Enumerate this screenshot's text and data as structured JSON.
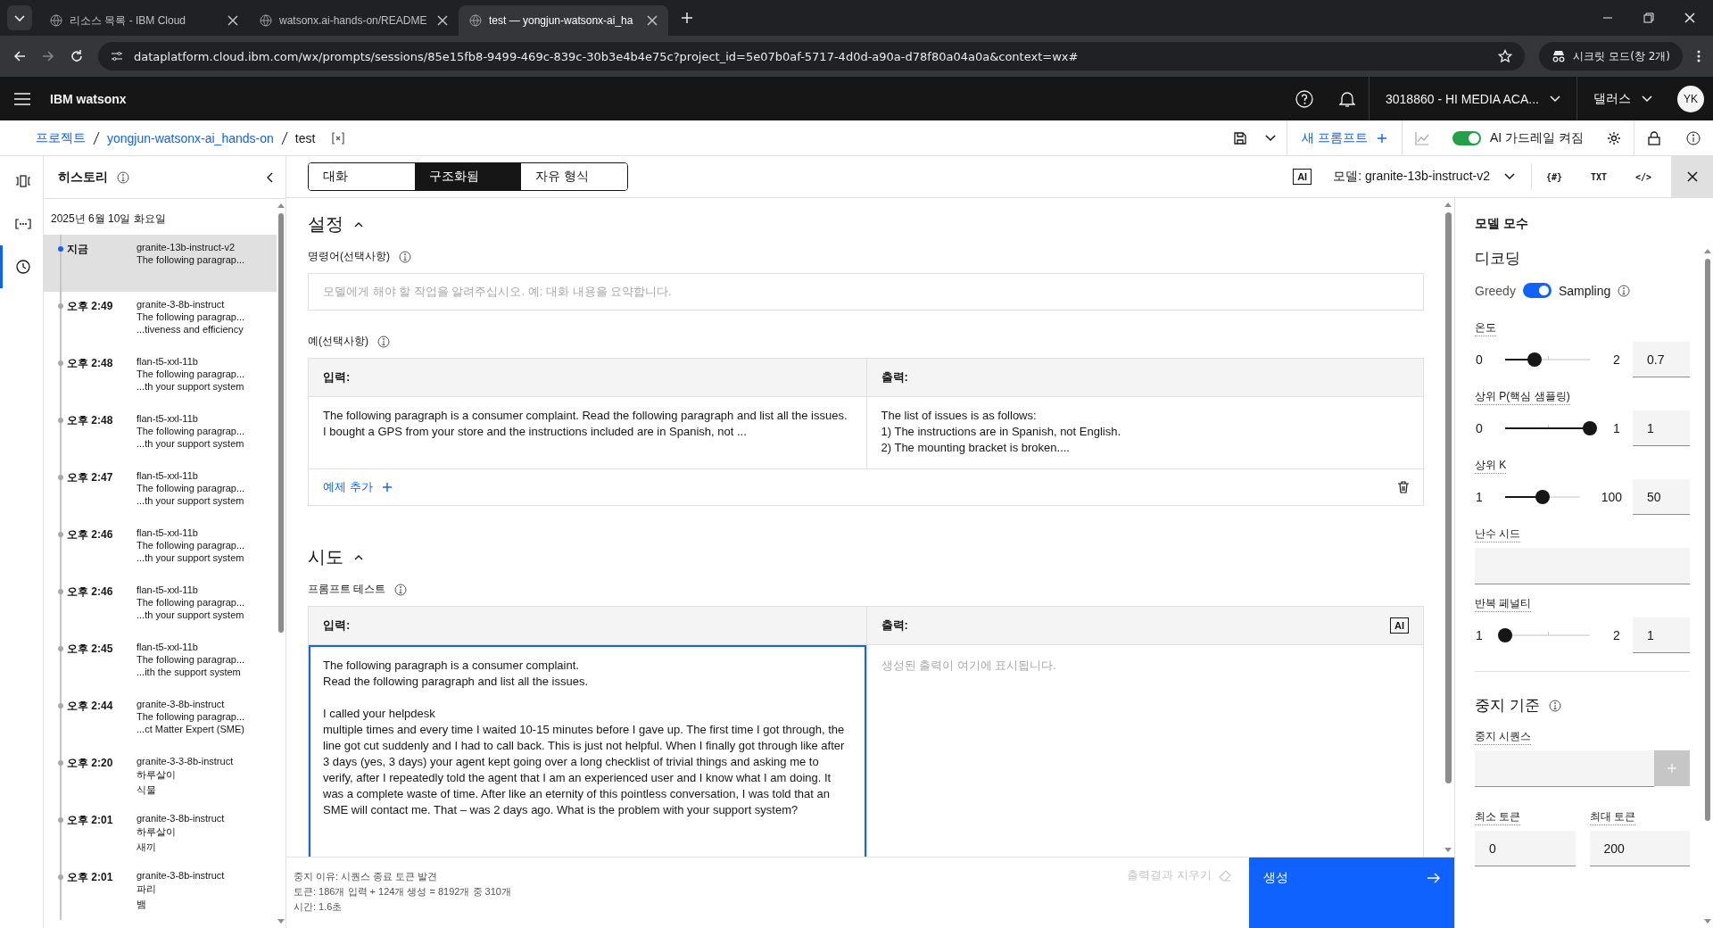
{
  "browser": {
    "tabs": [
      {
        "title": "리소스 목록 - IBM Cloud",
        "selected": false
      },
      {
        "title": "watsonx.ai-hands-on/README",
        "selected": false
      },
      {
        "title": "test — yongjun-watsonx-ai_ha",
        "selected": true
      }
    ],
    "url": "dataplatform.cloud.ibm.com/wx/prompts/sessions/85e15fb8-9499-469c-839c-30b3e4b4e75c?project_id=5e07b0af-5717-4d0d-a90a-d78f80a04a0a&context=wx#",
    "incognito": "시크릿 모드(창 2개)"
  },
  "app_header": {
    "brand": "IBM watsonx",
    "account": "3018860 - HI MEDIA ACA...",
    "region": "댈러스",
    "avatar": "YK"
  },
  "breadcrumb": [
    "프로젝트",
    "yongjun-watsonx-ai_hands-on",
    "test"
  ],
  "toolbar": {
    "new_prompt": "새 프롬프트",
    "guardrail_label": "AI 가드레일 켜짐",
    "guardrail_on": true
  },
  "rail": [
    {
      "selected": false
    },
    {
      "selected": false
    },
    {
      "selected": true
    }
  ],
  "history": {
    "title": "히스토리",
    "date": "2025년 6월 10일 화요일",
    "items": [
      {
        "time": "지금",
        "model": "granite-13b-instruct-v2",
        "lines": [
          "The following paragrap..."
        ],
        "selected": true
      },
      {
        "time": "오후 2:49",
        "model": "granite-3-8b-instruct",
        "lines": [
          "The following paragrap...",
          "...tiveness and efficiency"
        ],
        "selected": false
      },
      {
        "time": "오후 2:48",
        "model": "flan-t5-xxl-11b",
        "lines": [
          "The following paragrap...",
          "...th your support system"
        ],
        "selected": false
      },
      {
        "time": "오후 2:48",
        "model": "flan-t5-xxl-11b",
        "lines": [
          "The following paragrap...",
          "...th your support system"
        ],
        "selected": false
      },
      {
        "time": "오후 2:47",
        "model": "flan-t5-xxl-11b",
        "lines": [
          "The following paragrap...",
          "...th your support system"
        ],
        "selected": false
      },
      {
        "time": "오후 2:46",
        "model": "flan-t5-xxl-11b",
        "lines": [
          "The following paragrap...",
          "...th your support system"
        ],
        "selected": false
      },
      {
        "time": "오후 2:46",
        "model": "flan-t5-xxl-11b",
        "lines": [
          "The following paragrap...",
          "...th your support system"
        ],
        "selected": false
      },
      {
        "time": "오후 2:45",
        "model": "flan-t5-xxl-11b",
        "lines": [
          "The following paragrap...",
          "...ith the support system"
        ],
        "selected": false
      },
      {
        "time": "오후 2:44",
        "model": "granite-3-8b-instruct",
        "lines": [
          "The following paragrap...",
          "...ct Matter Expert (SME)"
        ],
        "selected": false
      },
      {
        "time": "오후 2:20",
        "model": "granite-3-3-8b-instruct",
        "lines": [
          "하루살이",
          "식물"
        ],
        "selected": false
      },
      {
        "time": "오후 2:01",
        "model": "granite-3-8b-instruct",
        "lines": [
          "하루살이",
          "새끼"
        ],
        "selected": false
      },
      {
        "time": "오후 2:01",
        "model": "granite-3-8b-instruct",
        "lines": [
          "파리",
          "뱀"
        ],
        "selected": false
      }
    ]
  },
  "mode_tabs": [
    {
      "label": "대화",
      "selected": false
    },
    {
      "label": "구조화됨",
      "selected": true
    },
    {
      "label": "자유 형식",
      "selected": false
    }
  ],
  "model_bar": {
    "ai_badge": "AI",
    "model": "모델: granite-13b-instruct-v2",
    "views": [
      "{#}",
      "TXT",
      "</>"
    ]
  },
  "setup": {
    "title": "설정",
    "instruction_label": "명령어(선택사항)",
    "instruction_placeholder": "모델에게 해야 할 작업을 알려주십시오. 예: 대화 내용을 요약합니다.",
    "examples_label": "예(선택사항)",
    "columns": [
      "입력:",
      "출력:"
    ],
    "example_input": "The following paragraph is a consumer complaint. Read the following paragraph and list all the issues.\nI bought a GPS from your store and the instructions included are in Spanish, not ...",
    "example_output": "The list of issues is as follows:\n1) The instructions are in Spanish, not English.\n2) The mounting bracket is broken....",
    "add_example": "예제 추가"
  },
  "try": {
    "title": "시도",
    "label": "프롬프트 테스트",
    "columns": [
      "입력:",
      "출력:"
    ],
    "ai_badge": "AI",
    "input": "The following paragraph is a consumer complaint.\nRead the following paragraph and list all the issues.\n\nI called your helpdesk\nmultiple times and every time I waited 10-15 minutes before I gave up. The first time I got through, the line got cut suddenly and I had to call back. This is just not helpful. When I finally got through like after 3 days (yes, 3 days) your agent kept going over a long checklist of trivial things and asking me to verify, after I repeatedly told the agent that I am an experienced user and I know what I am doing. It was a complete waste of time. After like an eternity of this pointless conversation, I was told that an SME will contact me. That – was 2 days ago. What is the problem with your support system?",
    "output_placeholder": "생성된 출력이 여기에 표시됩니다."
  },
  "footer": {
    "stats": [
      "중지 이유: 시퀀스 종료 토큰 발견",
      "토큰: 186개 입력 + 124개 생성 = 8192개 중 310개",
      "시간: 1.6초"
    ],
    "clear": "출력결과 지우기",
    "generate": "생성"
  },
  "params": {
    "title": "모델 모수",
    "decoding_title": "디코딩",
    "greedy": "Greedy",
    "sampling": "Sampling",
    "sampling_on": true,
    "items": [
      {
        "kind": "slider",
        "label": "온도",
        "min": "0",
        "max": "2",
        "value": "0.7",
        "level": 0.35
      },
      {
        "kind": "slider",
        "label": "상위 P(핵심 샘플링)",
        "min": "0",
        "max": "1",
        "value": "1",
        "level": 1
      },
      {
        "kind": "slider",
        "label": "상위 K",
        "min": "1",
        "max": "100",
        "value": "50",
        "level": 0.5
      },
      {
        "kind": "field",
        "label": "난수 시드"
      },
      {
        "kind": "slider",
        "label": "반복 페널티",
        "min": "1",
        "max": "2",
        "value": "1",
        "level": 0
      }
    ],
    "stop_title": "중지 기준",
    "stop_sequence_label": "중지 시퀀스",
    "min_tokens_label": "최소 토큰",
    "min_tokens": "0",
    "max_tokens_label": "최대 토큰",
    "max_tokens": "200"
  }
}
